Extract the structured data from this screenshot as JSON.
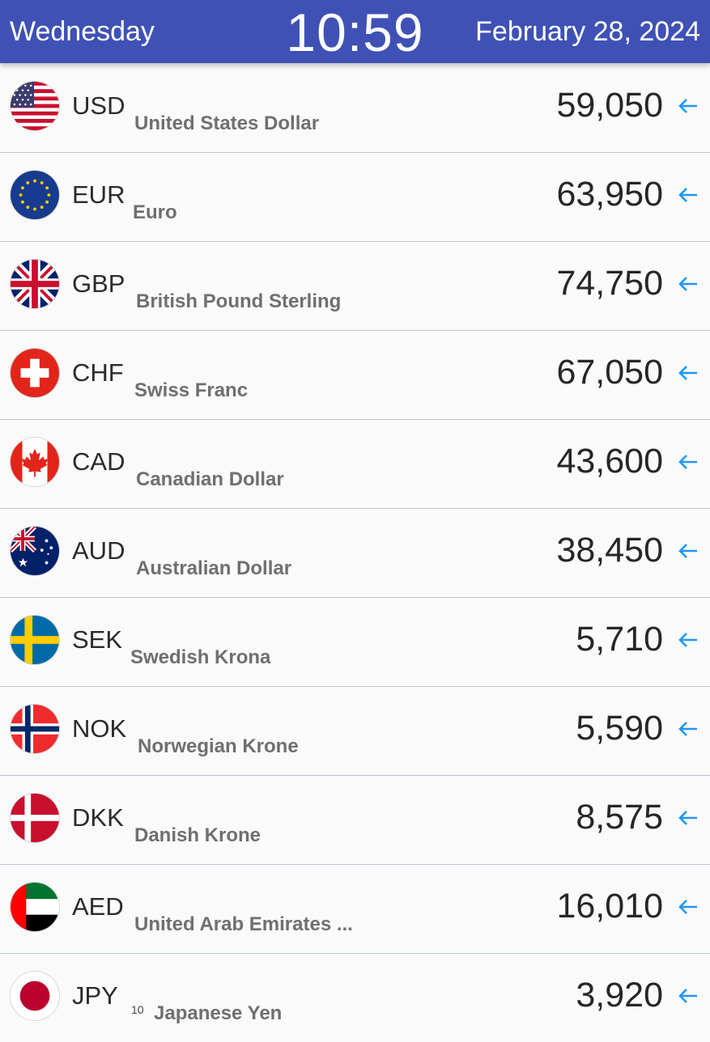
{
  "header": {
    "day": "Wednesday",
    "time": "10:59",
    "date": "February 28, 2024"
  },
  "rates": [
    {
      "code": "USD",
      "name": "United States Dollar",
      "value": "59,050",
      "flag_icon": "us-flag-icon"
    },
    {
      "code": "EUR",
      "name": "Euro",
      "value": "63,950",
      "flag_icon": "eu-flag-icon"
    },
    {
      "code": "GBP",
      "name": "British Pound Sterling",
      "value": "74,750",
      "flag_icon": "uk-flag-icon"
    },
    {
      "code": "CHF",
      "name": "Swiss Franc",
      "value": "67,050",
      "flag_icon": "swiss-flag-icon"
    },
    {
      "code": "CAD",
      "name": "Canadian Dollar",
      "value": "43,600",
      "flag_icon": "canada-flag-icon"
    },
    {
      "code": "AUD",
      "name": "Australian Dollar",
      "value": "38,450",
      "flag_icon": "australia-flag-icon"
    },
    {
      "code": "SEK",
      "name": "Swedish Krona",
      "value": "5,710",
      "flag_icon": "sweden-flag-icon"
    },
    {
      "code": "NOK",
      "name": "Norwegian Krone",
      "value": "5,590",
      "flag_icon": "norway-flag-icon"
    },
    {
      "code": "DKK",
      "name": "Danish Krone",
      "value": "8,575",
      "flag_icon": "denmark-flag-icon"
    },
    {
      "code": "AED",
      "name": "United Arab Emirates ...",
      "value": "16,010",
      "flag_icon": "uae-flag-icon"
    },
    {
      "code": "JPY",
      "name": "Japanese Yen",
      "value": "3,920",
      "flag_icon": "japan-flag-icon"
    }
  ],
  "footnote": "10",
  "colors": {
    "header": "#3f51b5",
    "arrow": "#2196f3",
    "divider": "#b7c5d3"
  }
}
